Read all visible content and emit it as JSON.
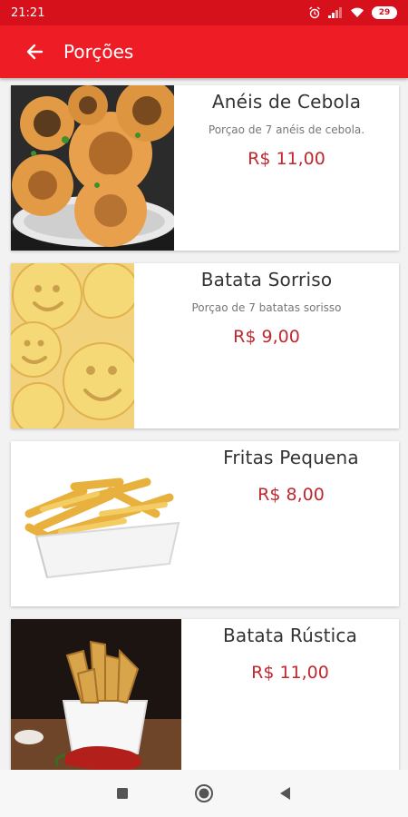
{
  "status_bar": {
    "time": "21:21",
    "battery": "29",
    "icons": [
      "alarm-icon",
      "signal-icon",
      "wifi-icon",
      "battery-icon"
    ]
  },
  "app_bar": {
    "title": "Porções",
    "back_icon": "arrow-left-icon",
    "background": "#ee1c25"
  },
  "colors": {
    "primary": "#ee1c25",
    "status_bar": "#d6111c",
    "price": "#c0282e"
  },
  "products": [
    {
      "name": "Anéis de Cebola",
      "description": "Porçao de 7 anéis de cebola.",
      "price": "R$ 11,00",
      "image": "onion-rings-image"
    },
    {
      "name": "Batata Sorriso",
      "description": "Porçao de 7 batatas sorisso",
      "price": "R$ 9,00",
      "image": "smiley-potatoes-image"
    },
    {
      "name": "Fritas Pequena",
      "description": "",
      "price": "R$ 8,00",
      "image": "french-fries-image"
    },
    {
      "name": "Batata Rústica",
      "description": "",
      "price": "R$ 11,00",
      "image": "rustic-potatoes-image"
    }
  ],
  "nav_bar": {
    "icons": [
      "recents-square-icon",
      "home-circle-icon",
      "back-triangle-icon"
    ]
  }
}
